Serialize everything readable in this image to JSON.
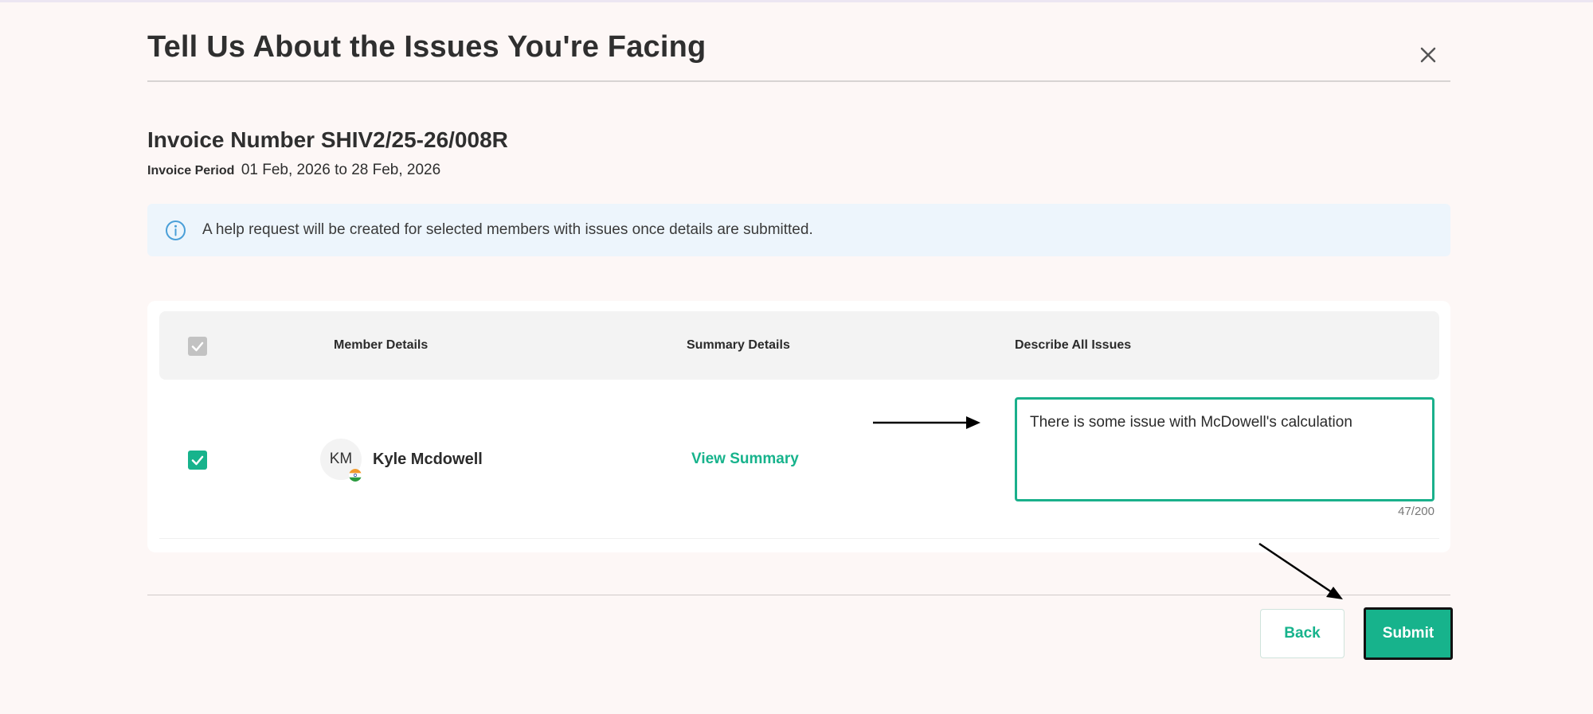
{
  "modal": {
    "title": "Tell Us About the Issues You're Facing",
    "close_icon": "close-icon"
  },
  "invoice": {
    "number_label": "Invoice Number SHIV2/25-26/008R",
    "period_label": "Invoice Period",
    "period_value": "01 Feb, 2026 to 28 Feb, 2026"
  },
  "info_banner": {
    "icon": "info-icon",
    "text": "A help request will be created for selected members with issues once details are submitted."
  },
  "table": {
    "headers": {
      "member": "Member Details",
      "summary": "Summary Details",
      "issues": "Describe All Issues"
    },
    "select_all_checked": true,
    "rows": [
      {
        "checked": true,
        "initials": "KM",
        "name": "Kyle Mcdowell",
        "flag_icon": "india-flag-icon",
        "summary_link": "View Summary",
        "issue_text": "There is some issue with McDowell's calculation",
        "char_count": "47/200"
      }
    ]
  },
  "footer": {
    "back_label": "Back",
    "submit_label": "Submit"
  },
  "colors": {
    "accent": "#17b38c",
    "background": "#fdf7f6",
    "banner": "#edf5fc"
  }
}
